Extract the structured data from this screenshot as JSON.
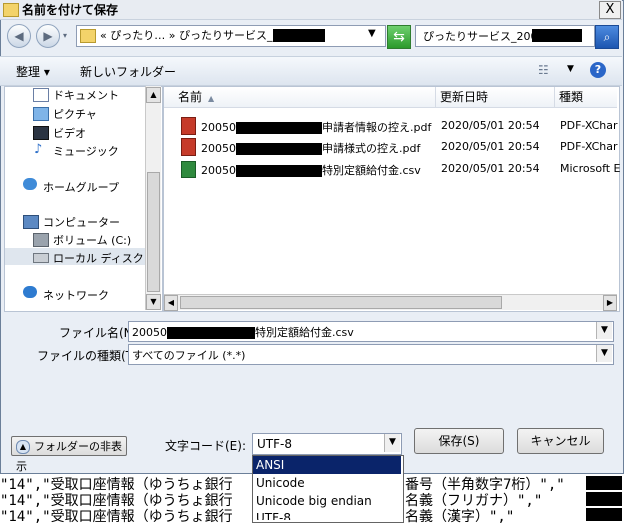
{
  "window": {
    "title": "名前を付けて保存",
    "close_label": "X"
  },
  "nav": {
    "address_text": "« ぴったり… » ぴったりサービス_20050",
    "search_text": "ぴったりサービス_20050"
  },
  "toolbar": {
    "organize_label": "整理 ▾",
    "new_folder_label": "新しいフォルダー"
  },
  "tree": [
    {
      "label": "ドキュメント",
      "icon": "document-icon"
    },
    {
      "label": "ピクチャ",
      "icon": "picture-icon"
    },
    {
      "label": "ビデオ",
      "icon": "video-icon"
    },
    {
      "label": "ミュージック",
      "icon": "music-icon"
    },
    {
      "label": "ホームグループ",
      "icon": "homegroup-icon"
    },
    {
      "label": "コンピューター",
      "icon": "computer-icon"
    },
    {
      "label": "ボリューム (C:)",
      "icon": "drive-icon"
    },
    {
      "label": "ローカル ディスク (E",
      "icon": "disk-icon"
    },
    {
      "label": "ネットワーク",
      "icon": "network-icon"
    }
  ],
  "columns": {
    "name": "名前",
    "date": "更新日時",
    "type": "種類"
  },
  "files": [
    {
      "name_prefix": "20050",
      "name_suffix": "申請者情報の控え.pdf",
      "date": "2020/05/01 20:54",
      "type": "PDF-XChar",
      "icon": "pdf-icon"
    },
    {
      "name_prefix": "20050",
      "name_suffix": "申請様式の控え.pdf",
      "date": "2020/05/01 20:54",
      "type": "PDF-XChar",
      "icon": "pdf-icon"
    },
    {
      "name_prefix": "20050",
      "name_suffix": "特別定額給付金.csv",
      "date": "2020/05/01 20:54",
      "type": "Microsoft E",
      "icon": "csv-icon"
    }
  ],
  "form": {
    "filename_label": "ファイル名(N):",
    "filename_prefix": "20050",
    "filename_suffix": "特別定額給付金.csv",
    "filetype_label": "ファイルの種類(T):",
    "filetype_value": "すべてのファイル (*.*)"
  },
  "footer": {
    "hide_folders_label": "フォルダーの非表示",
    "encoding_label": "文字コード(E):",
    "encoding_value": "UTF-8",
    "save_label": "保存(S)",
    "cancel_label": "キャンセル"
  },
  "encoding_options": [
    "ANSI",
    "Unicode",
    "Unicode big endian",
    "UTF-8"
  ],
  "background_lines": [
    "\"14\",\"受取口座情報（ゆうちょ銀行",
    "\"14\",\"受取口座情報（ゆうちょ銀行",
    "\"14\",\"受取口座情報（ゆうちょ銀行"
  ],
  "background_tails": [
    "番号（半角数字7桁）\",\"",
    "名義（フリガナ）\",\"",
    "名義（漢字）\",\""
  ]
}
